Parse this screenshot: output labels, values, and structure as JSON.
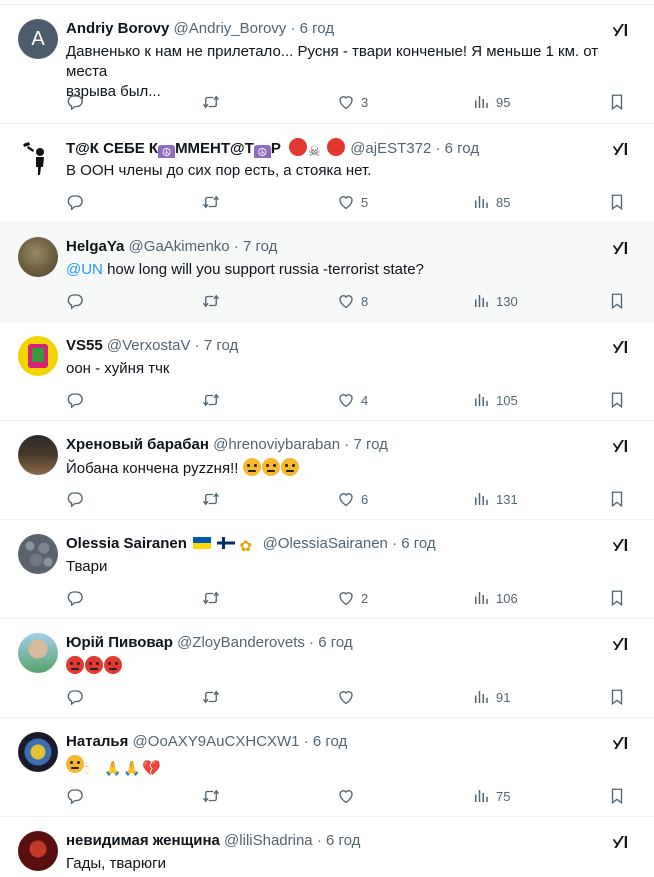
{
  "colors": {
    "accent": "#1d9bf0",
    "secondary_text": "#536471",
    "divider": "#eff3f4",
    "highlight_row": "#f7f9f9"
  },
  "icons": {
    "reply": "reply-icon",
    "repost": "repost-icon",
    "like": "like-icon",
    "views": "views-icon",
    "bookmark": "bookmark-icon",
    "grok": "grok-icon",
    "more": "more-icon"
  },
  "tweets": [
    {
      "name": "Andriy Borovy",
      "handle": "@Andriy_Borovy",
      "dot": "·",
      "time": "6 год",
      "avatar_letter": "A",
      "text_line1": "Давненько к нам не прилетало... Русня - твари конченые! Я меньше 1 км. от места",
      "text_line2": "взрыва был...",
      "likes": "3",
      "views": "95"
    },
    {
      "name_part1": "Т@К СЕБЕ К",
      "name_part2": "ММЕНТ@Т",
      "name_part3": "Р",
      "handle": "@ajEST372",
      "dot": "·",
      "time": "6 год",
      "text": "В ООН члены до сих пор есть, а стояка нет.",
      "likes": "5",
      "views": "85"
    },
    {
      "name": "HelgaYa",
      "handle": "@GaAkimenko",
      "dot": "·",
      "time": "7 год",
      "mention": "@UN",
      "text": " how long will you support russia -terrorist state?",
      "likes": "8",
      "views": "130"
    },
    {
      "name": "VS55",
      "handle": "@VerxostaV",
      "dot": "·",
      "time": "7 год",
      "text": "оон - хуйня тчк",
      "likes": "4",
      "views": "105"
    },
    {
      "name": "Хреновый барабан",
      "handle": "@hrenoviybaraban",
      "dot": "·",
      "time": "7 год",
      "text": "Йобана кончена pyzzня!!",
      "likes": "6",
      "views": "131"
    },
    {
      "name": "Olessia Sairanen",
      "handle": "@OlessiaSairanen",
      "dot": "·",
      "time": "6 год",
      "text": "Твари",
      "likes": "2",
      "views": "106"
    },
    {
      "name": "Юрій Пивовар",
      "handle": "@ZloyBanderovets",
      "dot": "·",
      "time": "6 год",
      "views": "91"
    },
    {
      "name": "Наталья",
      "handle": "@OoAXY9AuCXHCXW1",
      "dot": "·",
      "time": "6 год",
      "views": "75"
    },
    {
      "name": "невидимая женщина",
      "handle": "@liliShadrina",
      "dot": "·",
      "time": "6 год",
      "text": "Гады, тварюги"
    }
  ]
}
